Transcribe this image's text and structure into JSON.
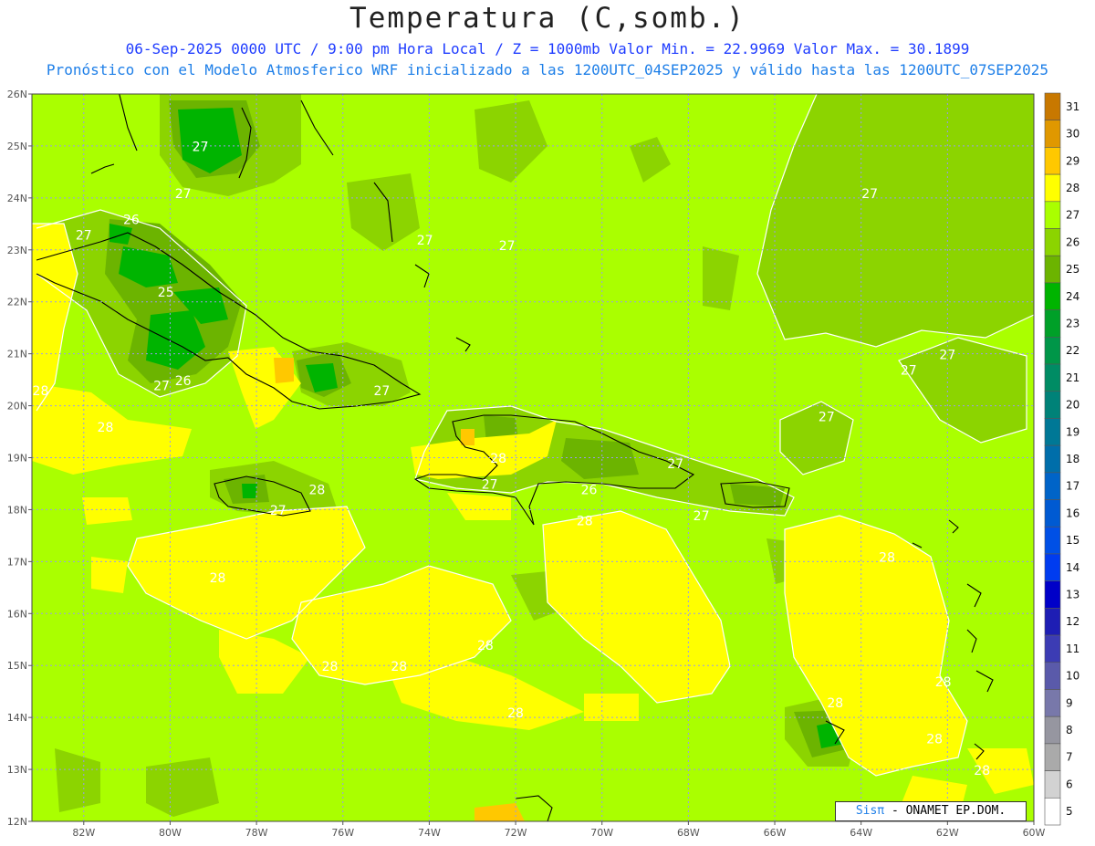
{
  "title": "Temperatura (C,somb.)",
  "subtitle1": "06-Sep-2025  0000 UTC / 9:00 pm Hora Local / Z = 1000mb   Valor Min. = 22.9969  Valor Max. = 30.1899",
  "subtitle2": "Pronóstico con el Modelo Atmosferico WRF inicializado a las 1200UTC_04SEP2025 y válido hasta las  1200UTC_07SEP2025",
  "credit": {
    "brand": "Sisπ",
    "rest": " - ONAMET  EP.DOM."
  },
  "lat_labels": [
    "26N",
    "25N",
    "24N",
    "23N",
    "22N",
    "21N",
    "20N",
    "19N",
    "18N",
    "17N",
    "16N",
    "15N",
    "14N",
    "13N",
    "12N"
  ],
  "lon_labels": [
    "82W",
    "80W",
    "78W",
    "76W",
    "74W",
    "72W",
    "70W",
    "68W",
    "66W",
    "64W",
    "62W",
    "60W"
  ],
  "colorbar": {
    "levels": [
      "31",
      "30",
      "29",
      "28",
      "27",
      "26",
      "25",
      "24",
      "23",
      "22",
      "21",
      "20",
      "19",
      "18",
      "17",
      "16",
      "15",
      "14",
      "13",
      "12",
      "11",
      "10",
      "9",
      "8",
      "7",
      "6",
      "5"
    ],
    "colors": [
      "#c87800",
      "#e09800",
      "#ffc800",
      "#ffff00",
      "#aaff00",
      "#8cd400",
      "#6cb400",
      "#00b400",
      "#00a028",
      "#009648",
      "#008c64",
      "#008278",
      "#007896",
      "#006eaa",
      "#0064c8",
      "#005ad2",
      "#0050e6",
      "#003cf0",
      "#0000c8",
      "#1e1eb4",
      "#3c3cb4",
      "#5a5aaa",
      "#7878aa",
      "#9696a0",
      "#aaaaaa",
      "#d2d2d2",
      "#ffffff"
    ]
  },
  "contour_labels": [
    {
      "text": "27",
      "lon": -79.3,
      "lat": 24.9
    },
    {
      "text": "27",
      "lon": -79.7,
      "lat": 24.0
    },
    {
      "text": "26",
      "lon": -80.9,
      "lat": 23.5
    },
    {
      "text": "27",
      "lon": -82.0,
      "lat": 23.2
    },
    {
      "text": "25",
      "lon": -80.1,
      "lat": 22.1
    },
    {
      "text": "26",
      "lon": -79.7,
      "lat": 20.4
    },
    {
      "text": "27",
      "lon": -80.2,
      "lat": 20.3
    },
    {
      "text": "28",
      "lon": -83.0,
      "lat": 20.2
    },
    {
      "text": "28",
      "lon": -81.5,
      "lat": 19.5
    },
    {
      "text": "27",
      "lon": -75.1,
      "lat": 20.2
    },
    {
      "text": "27",
      "lon": -74.1,
      "lat": 23.1
    },
    {
      "text": "27",
      "lon": -72.2,
      "lat": 23.0
    },
    {
      "text": "27",
      "lon": -63.8,
      "lat": 24.0
    },
    {
      "text": "27",
      "lon": -62.0,
      "lat": 20.9
    },
    {
      "text": "27",
      "lon": -62.9,
      "lat": 20.6
    },
    {
      "text": "27",
      "lon": -64.8,
      "lat": 19.7
    },
    {
      "text": "27",
      "lon": -68.3,
      "lat": 18.8
    },
    {
      "text": "27",
      "lon": -72.6,
      "lat": 18.4
    },
    {
      "text": "28",
      "lon": -72.4,
      "lat": 18.9
    },
    {
      "text": "26",
      "lon": -70.3,
      "lat": 18.3
    },
    {
      "text": "27",
      "lon": -67.7,
      "lat": 17.8
    },
    {
      "text": "28",
      "lon": -76.6,
      "lat": 18.3
    },
    {
      "text": "27",
      "lon": -77.5,
      "lat": 17.9
    },
    {
      "text": "28",
      "lon": -78.9,
      "lat": 16.6
    },
    {
      "text": "28",
      "lon": -70.4,
      "lat": 17.7
    },
    {
      "text": "28",
      "lon": -63.4,
      "lat": 17.0
    },
    {
      "text": "28",
      "lon": -72.7,
      "lat": 15.3
    },
    {
      "text": "28",
      "lon": -76.3,
      "lat": 14.9
    },
    {
      "text": "28",
      "lon": -74.7,
      "lat": 14.9
    },
    {
      "text": "28",
      "lon": -72.0,
      "lat": 14.0
    },
    {
      "text": "28",
      "lon": -64.6,
      "lat": 14.2
    },
    {
      "text": "28",
      "lon": -62.1,
      "lat": 14.6
    },
    {
      "text": "28",
      "lon": -62.3,
      "lat": 13.5
    },
    {
      "text": "28",
      "lon": -61.2,
      "lat": 12.9
    }
  ]
}
